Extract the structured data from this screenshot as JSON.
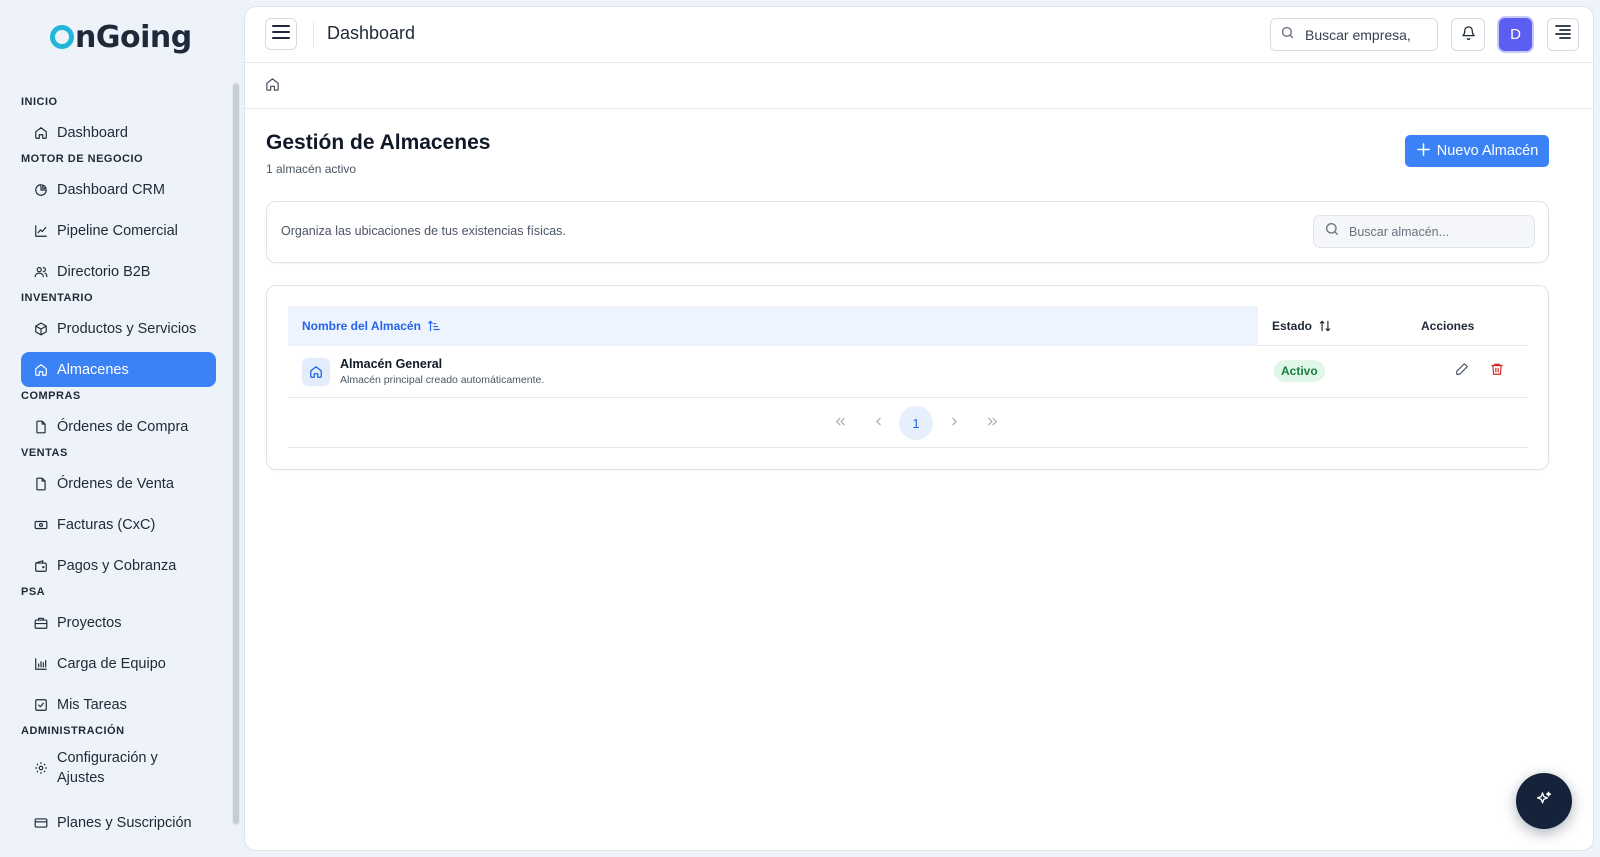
{
  "brand": {
    "name_first_letter": "O",
    "name_rest": "nGoing",
    "accent": "#22b6d8"
  },
  "sidebar": {
    "sections": {
      "inicio": "INICIO",
      "motor": "MOTOR DE NEGOCIO",
      "inventario": "INVENTARIO",
      "compras": "COMPRAS",
      "ventas": "VENTAS",
      "psa": "PSA",
      "admin": "ADMINISTRACIÓN"
    },
    "items": {
      "dashboard": {
        "label": "Dashboard",
        "icon": "home-icon"
      },
      "dashboard_crm": {
        "label": "Dashboard CRM",
        "icon": "pie-chart-icon"
      },
      "pipeline": {
        "label": "Pipeline Comercial",
        "icon": "trending-icon"
      },
      "directorio": {
        "label": "Directorio B2B",
        "icon": "users-icon"
      },
      "productos": {
        "label": "Productos y Servicios",
        "icon": "box-icon"
      },
      "almacenes": {
        "label": "Almacenes",
        "icon": "warehouse-icon",
        "active": true
      },
      "ordenes_compra": {
        "label": "Órdenes de Compra",
        "icon": "file-icon"
      },
      "ordenes_venta": {
        "label": "Órdenes de Venta",
        "icon": "file-icon"
      },
      "facturas": {
        "label": "Facturas (CxC)",
        "icon": "banknote-icon"
      },
      "pagos": {
        "label": "Pagos y Cobranza",
        "icon": "wallet-icon"
      },
      "proyectos": {
        "label": "Proyectos",
        "icon": "briefcase-icon"
      },
      "carga": {
        "label": "Carga de Equipo",
        "icon": "bar-chart-icon"
      },
      "tareas": {
        "label": "Mis Tareas",
        "icon": "check-square-icon"
      },
      "config": {
        "label": "Configuración y Ajustes",
        "icon": "gear-icon"
      },
      "planes": {
        "label": "Planes y Suscripción",
        "icon": "credit-card-icon"
      }
    }
  },
  "header": {
    "title": "Dashboard",
    "search_placeholder": "Buscar empresa,",
    "avatar_initial": "D"
  },
  "page": {
    "title": "Gestión de Almacenes",
    "subtitle": "1 almacén activo",
    "new_button": "Nuevo Almacén",
    "description": "Organiza las ubicaciones de tus existencias físicas.",
    "search_placeholder": "Buscar almacén..."
  },
  "table": {
    "columns": {
      "name": "Nombre del Almacén",
      "status": "Estado",
      "actions": "Acciones"
    },
    "rows": [
      {
        "name": "Almacén General",
        "description": "Almacén principal creado automáticamente.",
        "status": "Activo"
      }
    ]
  },
  "pagination": {
    "current_page": "1"
  },
  "colors": {
    "primary": "#3b82f6",
    "success": "#16803c",
    "danger": "#dc2626",
    "avatar": "#5b5ef0"
  }
}
